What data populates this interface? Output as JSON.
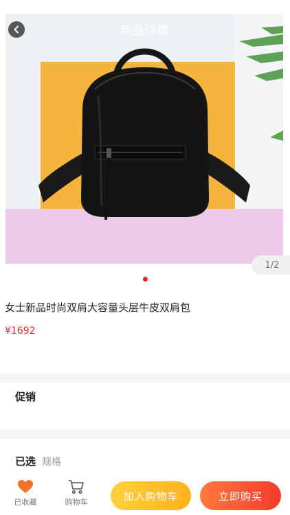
{
  "header": {
    "title": "商品详情",
    "back_icon": "chevron-left-icon"
  },
  "gallery": {
    "current_page": 1,
    "total_pages": 2,
    "counter_text": "1/2",
    "product_image": "black-leather-backpack-photo"
  },
  "product": {
    "title": "女士新品时尚双肩大容量头层牛皮双肩包",
    "price": "¥1692"
  },
  "sections": {
    "promo_label": "促销",
    "selected_label": "已选",
    "selected_value": "规格"
  },
  "bottom_bar": {
    "favorite_label": "已收藏",
    "favorite_icon": "heart-icon",
    "cart_label": "购物车",
    "cart_icon": "cart-icon",
    "add_to_cart": "加入购物车",
    "buy_now": "立即购买"
  },
  "colors": {
    "price": "#e3262b",
    "dot_active": "#e8231f",
    "add_to_cart_bg": "#ffc02b",
    "buy_now_bg": "#f5502f",
    "favorite_icon": "#f5722d"
  }
}
